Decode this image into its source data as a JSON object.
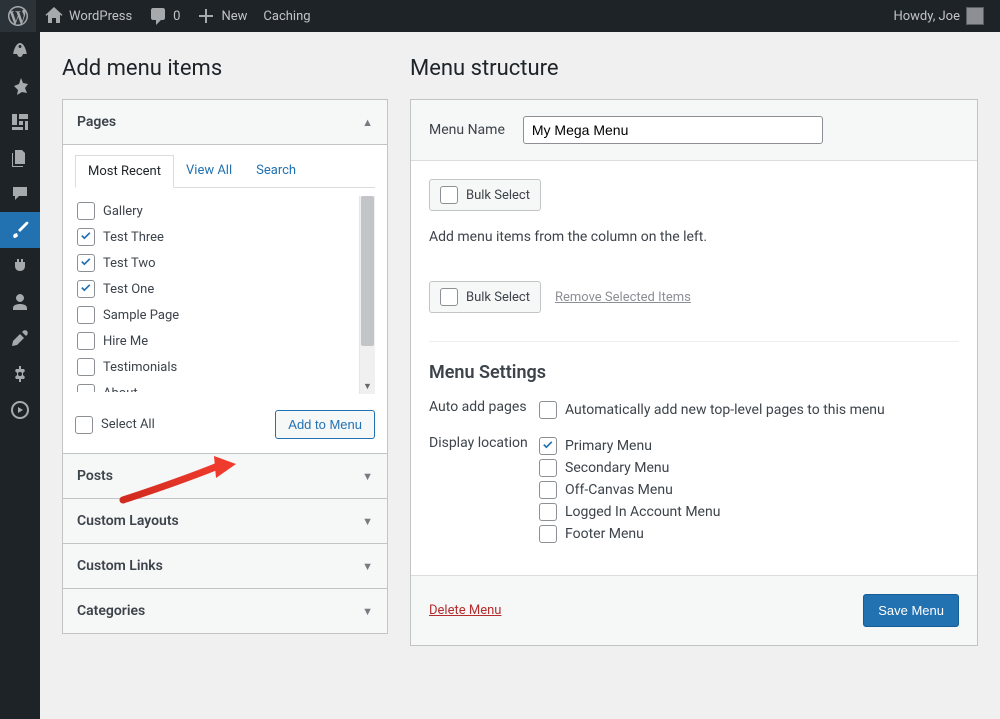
{
  "adminbar": {
    "site_name": "WordPress",
    "comments_count": "0",
    "new_label": "New",
    "caching_label": "Caching",
    "howdy": "Howdy, Joe"
  },
  "headings": {
    "add_items": "Add menu items",
    "structure": "Menu structure",
    "menu_settings": "Menu Settings"
  },
  "accordions": {
    "pages": "Pages",
    "posts": "Posts",
    "custom_layouts": "Custom Layouts",
    "custom_links": "Custom Links",
    "categories": "Categories"
  },
  "tabs": {
    "most_recent": "Most Recent",
    "view_all": "View All",
    "search": "Search"
  },
  "pages_list": [
    {
      "label": "Gallery",
      "checked": false
    },
    {
      "label": "Test Three",
      "checked": true
    },
    {
      "label": "Test Two",
      "checked": true
    },
    {
      "label": "Test One",
      "checked": true
    },
    {
      "label": "Sample Page",
      "checked": false
    },
    {
      "label": "Hire Me",
      "checked": false
    },
    {
      "label": "Testimonials",
      "checked": false
    },
    {
      "label": "About",
      "checked": false
    }
  ],
  "controls": {
    "select_all": "Select All",
    "add_to_menu": "Add to Menu",
    "menu_name_label": "Menu Name",
    "menu_name_value": "My Mega Menu",
    "bulk_select": "Bulk Select",
    "remove_selected": "Remove Selected Items",
    "help_text": "Add menu items from the column on the left.",
    "auto_add_label": "Auto add pages",
    "auto_add_desc": "Automatically add new top-level pages to this menu",
    "display_loc_label": "Display location",
    "delete_menu": "Delete Menu",
    "save_menu": "Save Menu"
  },
  "locations": [
    {
      "label": "Primary Menu",
      "checked": true
    },
    {
      "label": "Secondary Menu",
      "checked": false
    },
    {
      "label": "Off-Canvas Menu",
      "checked": false
    },
    {
      "label": "Logged In Account Menu",
      "checked": false
    },
    {
      "label": "Footer Menu",
      "checked": false
    }
  ]
}
